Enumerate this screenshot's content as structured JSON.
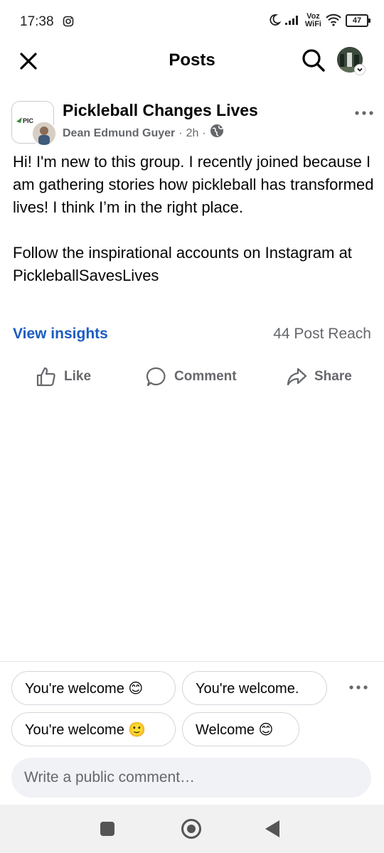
{
  "status_bar": {
    "time": "17:38",
    "wifi_label_top": "Voz",
    "wifi_label_bottom": "WiFi",
    "battery": "47"
  },
  "header": {
    "title": "Posts"
  },
  "post": {
    "group_name": "Pickleball Changes Lives",
    "author": "Dean Edmund Guyer",
    "time": "2h",
    "separator": "·",
    "group_logo_text": "PIC",
    "paragraphs": [
      "Hi! I'm new to this group. I recently joined because I am gathering stories how pickleball has transformed lives! I think I’m in the right place.",
      "Follow the inspirational accounts on Instagram at PickleballSavesLives"
    ],
    "view_insights": "View insights",
    "post_reach": "44 Post Reach",
    "actions": {
      "like": "Like",
      "comment": "Comment",
      "share": "Share"
    }
  },
  "quick_replies": [
    "You're welcome 😊",
    "You're welcome.",
    "You're welcome 🙂",
    "Welcome 😊"
  ],
  "comment_box": {
    "placeholder": "Write a public comment…"
  },
  "colors": {
    "link_blue": "#1b5cc1",
    "secondary_text": "#65676b",
    "input_bg": "#f0f2f5"
  }
}
